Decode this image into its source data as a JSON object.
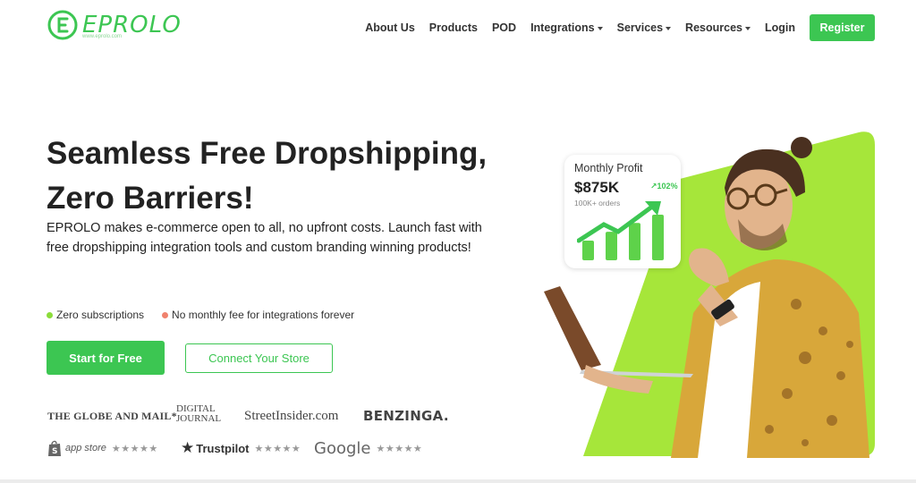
{
  "brand": {
    "name": "EPROLO",
    "tagline": "www.eprolo.com",
    "color": "#3cc652"
  },
  "nav": {
    "items": [
      {
        "label": "About Us",
        "dropdown": false
      },
      {
        "label": "Products",
        "dropdown": false
      },
      {
        "label": "POD",
        "dropdown": false
      },
      {
        "label": "Integrations",
        "dropdown": true
      },
      {
        "label": "Services",
        "dropdown": true
      },
      {
        "label": "Resources",
        "dropdown": true
      },
      {
        "label": "Login",
        "dropdown": false
      }
    ],
    "register_label": "Register"
  },
  "hero": {
    "headline_line1": "Seamless Free Dropshipping,",
    "headline_line2": "Zero Barriers!",
    "subtext": "EPROLO makes e-commerce open to all, no upfront costs. Launch fast with free dropshipping integration tools and custom branding winning products!",
    "bullets": [
      {
        "text": "Zero subscriptions",
        "color": "#8bdc3a"
      },
      {
        "text": "No monthly fee for integrations forever",
        "color": "#f0826e"
      }
    ],
    "primary_cta": "Start for Free",
    "secondary_cta": "Connect Your Store"
  },
  "press": {
    "globe": "THE GLOBE AND MAIL*",
    "digital_line1": "DIGITAL",
    "digital_line2": "JOURNAL",
    "street": "StreetInsider.com",
    "benzinga": "BENZINGA."
  },
  "ratings": {
    "appstore_label": "app store",
    "trustpilot_label": "Trustpilot",
    "google_label": "Google",
    "stars": "★★★★★"
  },
  "profit_card": {
    "title": "Monthly Profit",
    "amount": "$875K",
    "change": "102%",
    "orders": "100K+ orders",
    "bars": [
      0.38,
      0.55,
      0.72,
      0.88
    ]
  },
  "colors": {
    "accent": "#3cc652",
    "lime": "#a6e63a"
  }
}
